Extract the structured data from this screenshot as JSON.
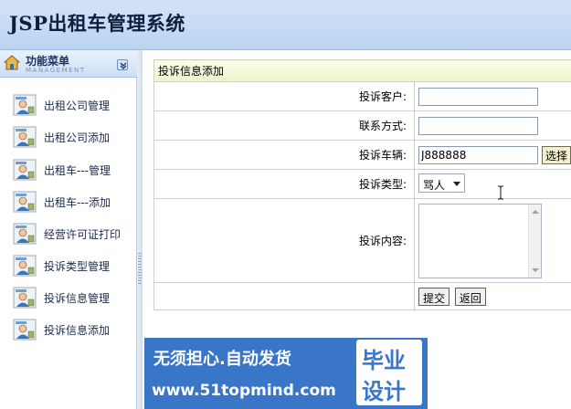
{
  "header": {
    "title": "JSP出租车管理系统"
  },
  "sidebar": {
    "menu_title": "功能菜单",
    "menu_subtitle": "MANAGEMENT",
    "items": [
      {
        "label": "出租公司管理"
      },
      {
        "label": "出租公司添加"
      },
      {
        "label": "出租车---管理"
      },
      {
        "label": "出租车---添加"
      },
      {
        "label": "经营许可证打印"
      },
      {
        "label": "投诉类型管理"
      },
      {
        "label": "投诉信息管理"
      },
      {
        "label": "投诉信息添加"
      }
    ]
  },
  "form": {
    "title": "投诉信息添加",
    "customer_label": "投诉客户:",
    "customer_value": "",
    "contact_label": "联系方式:",
    "contact_value": "",
    "vehicle_label": "投诉车辆:",
    "vehicle_value": "J888888",
    "choose_label": "选择",
    "type_label": "投诉类型:",
    "type_value": "骂人",
    "content_label": "投诉内容:",
    "content_value": "",
    "submit_label": "提交",
    "back_label": "返回"
  },
  "banner": {
    "line1": "无须担心.自动发货",
    "line2": "www.51topmind.com",
    "badge_line1": "毕业",
    "badge_line2": "设计"
  },
  "colors": {
    "header_bg": "#c8dcf3",
    "title_text": "#0d1f3c",
    "form_title_bg": "#f4f8dc",
    "banner_bg": "#3a76c8"
  },
  "icons": [
    "home-icon",
    "collapse-icon",
    "person-icon",
    "text-cursor-icon"
  ]
}
